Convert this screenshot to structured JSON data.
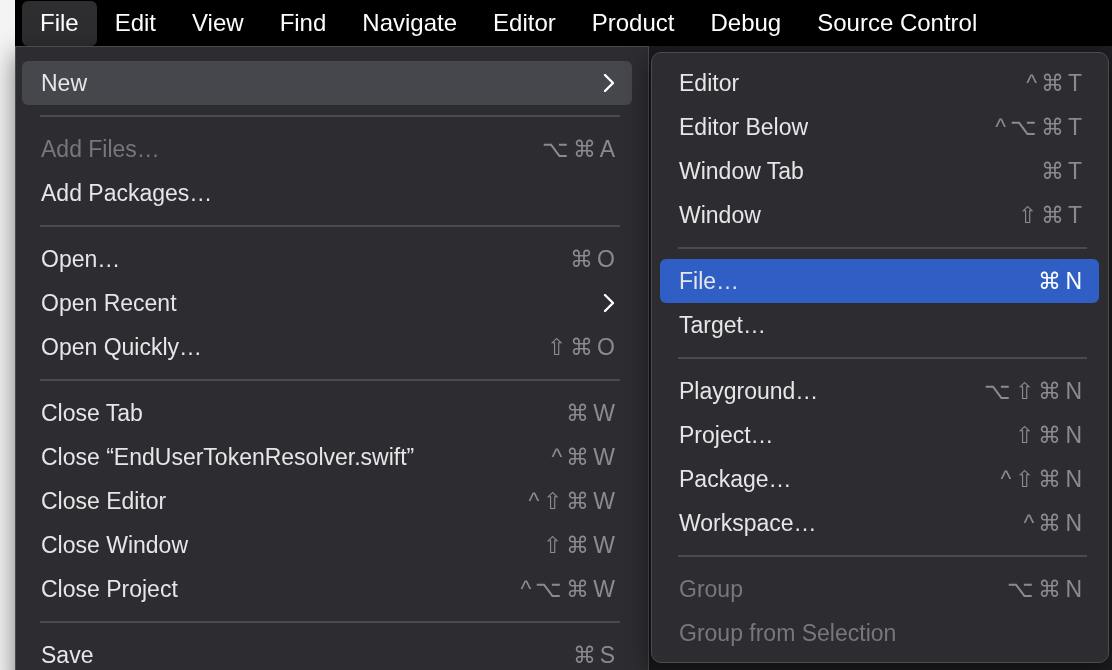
{
  "menu_bar": [
    {
      "label": "File",
      "selected": true
    },
    {
      "label": "Edit",
      "selected": false
    },
    {
      "label": "View",
      "selected": false
    },
    {
      "label": "Find",
      "selected": false
    },
    {
      "label": "Navigate",
      "selected": false
    },
    {
      "label": "Editor",
      "selected": false
    },
    {
      "label": "Product",
      "selected": false
    },
    {
      "label": "Debug",
      "selected": false
    },
    {
      "label": "Source Control",
      "selected": false
    }
  ],
  "file_menu": {
    "active": false,
    "items": [
      {
        "kind": "item",
        "label": "New",
        "submenu": true,
        "disabled": false,
        "selected": true
      },
      {
        "kind": "separator"
      },
      {
        "kind": "item",
        "label": "Add Files…",
        "shortcut": "⌥⌘A",
        "disabled": true,
        "selected": false
      },
      {
        "kind": "item",
        "label": "Add Packages…",
        "disabled": false,
        "selected": false
      },
      {
        "kind": "separator"
      },
      {
        "kind": "item",
        "label": "Open…",
        "shortcut": "⌘O",
        "disabled": false,
        "selected": false
      },
      {
        "kind": "item",
        "label": "Open Recent",
        "submenu": true,
        "disabled": false,
        "selected": false
      },
      {
        "kind": "item",
        "label": "Open Quickly…",
        "shortcut": "⇧⌘O",
        "disabled": false,
        "selected": false
      },
      {
        "kind": "separator"
      },
      {
        "kind": "item",
        "label": "Close Tab",
        "shortcut": "⌘W",
        "disabled": false,
        "selected": false
      },
      {
        "kind": "item",
        "label": "Close “EndUserTokenResolver.swift”",
        "shortcut": "^⌘W",
        "disabled": false,
        "selected": false
      },
      {
        "kind": "item",
        "label": "Close Editor",
        "shortcut": "^⇧⌘W",
        "disabled": false,
        "selected": false
      },
      {
        "kind": "item",
        "label": "Close Window",
        "shortcut": "⇧⌘W",
        "disabled": false,
        "selected": false
      },
      {
        "kind": "item",
        "label": "Close Project",
        "shortcut": "^⌥⌘W",
        "disabled": false,
        "selected": false
      },
      {
        "kind": "separator"
      },
      {
        "kind": "item",
        "label": "Save",
        "shortcut": "⌘S",
        "disabled": false,
        "selected": false
      }
    ]
  },
  "new_submenu": {
    "active": true,
    "items": [
      {
        "kind": "item",
        "label": "Editor",
        "shortcut": "^⌘T",
        "disabled": false,
        "selected": false
      },
      {
        "kind": "item",
        "label": "Editor Below",
        "shortcut": "^⌥⌘T",
        "disabled": false,
        "selected": false
      },
      {
        "kind": "item",
        "label": "Window Tab",
        "shortcut": "⌘T",
        "disabled": false,
        "selected": false
      },
      {
        "kind": "item",
        "label": "Window",
        "shortcut": "⇧⌘T",
        "disabled": false,
        "selected": false
      },
      {
        "kind": "separator"
      },
      {
        "kind": "item",
        "label": "File…",
        "shortcut": "⌘N",
        "disabled": false,
        "selected": true
      },
      {
        "kind": "item",
        "label": "Target…",
        "disabled": false,
        "selected": false
      },
      {
        "kind": "separator"
      },
      {
        "kind": "item",
        "label": "Playground…",
        "shortcut": "⌥⇧⌘N",
        "disabled": false,
        "selected": false
      },
      {
        "kind": "item",
        "label": "Project…",
        "shortcut": "⇧⌘N",
        "disabled": false,
        "selected": false
      },
      {
        "kind": "item",
        "label": "Package…",
        "shortcut": "^⇧⌘N",
        "disabled": false,
        "selected": false
      },
      {
        "kind": "item",
        "label": "Workspace…",
        "shortcut": "^⌘N",
        "disabled": false,
        "selected": false
      },
      {
        "kind": "separator"
      },
      {
        "kind": "item",
        "label": "Group",
        "shortcut": "⌥⌘N",
        "disabled": true,
        "selected": false
      },
      {
        "kind": "item",
        "label": "Group from Selection",
        "disabled": true,
        "selected": false
      }
    ]
  }
}
